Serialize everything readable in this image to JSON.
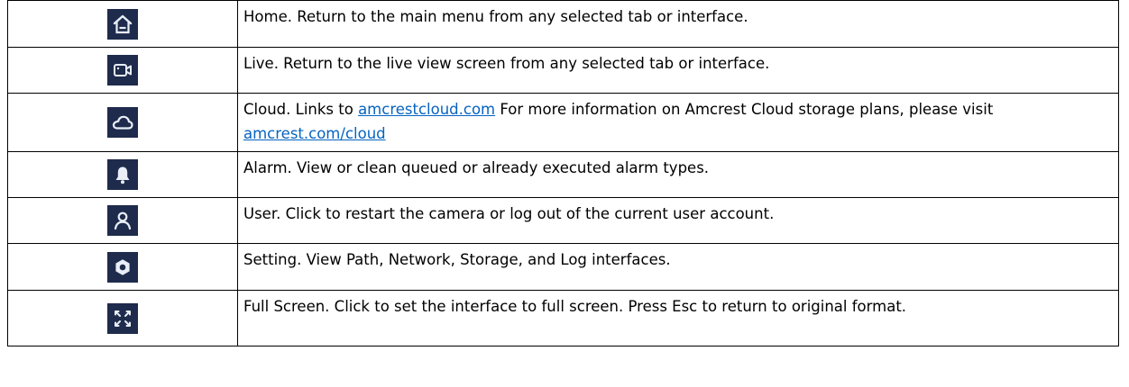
{
  "rows": [
    {
      "icon": "home-icon",
      "text": "Home. Return to the main menu from any selected tab or interface."
    },
    {
      "icon": "live-camera-icon",
      "text": "Live. Return to the live view screen from any selected tab or interface."
    },
    {
      "icon": "cloud-icon",
      "text_a": "Cloud. Links to ",
      "link1": "amcrestcloud.com",
      "text_b": " For more information on Amcrest Cloud storage plans, please visit ",
      "link2": "amcrest.com/cloud"
    },
    {
      "icon": "bell-icon",
      "text": "Alarm. View or clean queued or already executed alarm types."
    },
    {
      "icon": "user-icon",
      "text": "User. Click to restart the camera or log out of the current user account."
    },
    {
      "icon": "gear-icon",
      "text": "Setting. View Path, Network, Storage, and Log interfaces."
    },
    {
      "icon": "fullscreen-icon",
      "text": "Full Screen. Click to set the interface to full screen. Press Esc to return to original format."
    }
  ],
  "colors": {
    "tile": "#1e2b4c",
    "link": "#0563c1",
    "icon_stroke": "#e9eef7"
  }
}
